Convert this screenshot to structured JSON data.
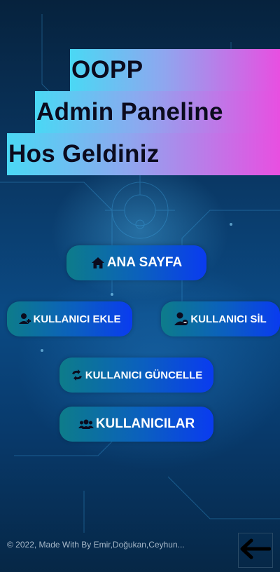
{
  "header": {
    "line1": "OOPP",
    "line2": "Admin Paneline",
    "line3": "Hos Geldiniz"
  },
  "nav": {
    "home": {
      "label": "ANA SAYFA",
      "icon": "home-icon"
    },
    "add_user": {
      "label": "KULLANICI EKLE",
      "icon": "user-plus-icon"
    },
    "delete_user": {
      "label": "KULLANICI SİL",
      "icon": "user-minus-icon"
    },
    "update_user": {
      "label": "KULLANICI GÜNCELLE",
      "icon": "sync-icon"
    },
    "users": {
      "label": "KULLANICILAR",
      "icon": "users-icon"
    }
  },
  "footer": {
    "copyright": "© 2022, Made With By Emir,Doğukan,Ceyhun..."
  },
  "back_button": {
    "icon": "arrow-left-icon"
  },
  "colors": {
    "title_gradient_start": "#4ad8f4",
    "title_gradient_end": "#e84fe1",
    "button_gradient_start": "#0d7c8a",
    "button_gradient_end": "#0a3bf0",
    "button_text": "#ffffff"
  }
}
